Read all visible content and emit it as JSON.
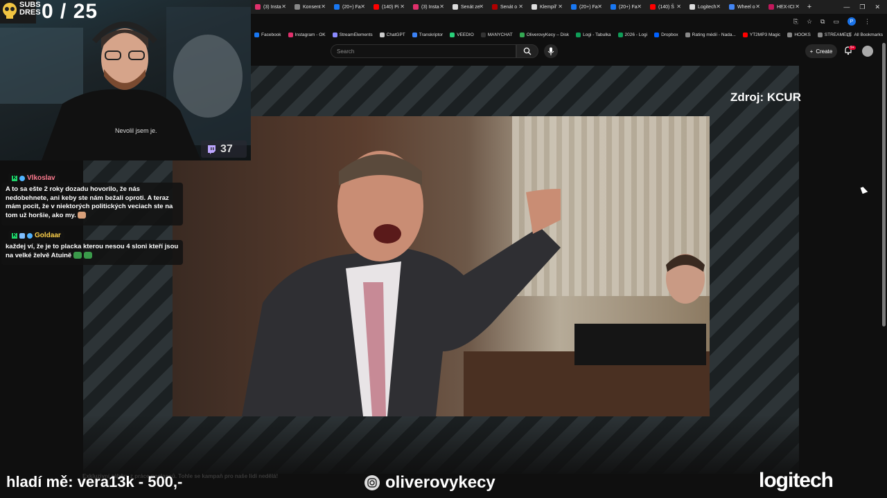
{
  "browser": {
    "tabs": [
      {
        "label": "(3) Insta",
        "color": "#e1306c"
      },
      {
        "label": "Konsent",
        "color": "#888888"
      },
      {
        "label": "(20+) Fa",
        "color": "#1877f2"
      },
      {
        "label": "(140) Pi",
        "color": "#ff0000"
      },
      {
        "label": "(3) Insta",
        "color": "#e1306c"
      },
      {
        "label": "Senát ze",
        "color": "#dddddd"
      },
      {
        "label": "Senát o",
        "color": "#b00000"
      },
      {
        "label": "Klempíř",
        "color": "#dddddd"
      },
      {
        "label": "(20+) Fa",
        "color": "#1877f2"
      },
      {
        "label": "(20+) Fa",
        "color": "#1877f2"
      },
      {
        "label": "(140) Š",
        "color": "#ff0000"
      },
      {
        "label": "Logitech",
        "color": "#dddddd"
      },
      {
        "label": "Wheel o",
        "color": "#4285f4"
      },
      {
        "label": "HEX-ICI",
        "color": "#c2185b"
      }
    ],
    "new_tab": "+",
    "profile_initial": "P",
    "bookmarks": [
      {
        "label": "Facebook",
        "color": "#1877f2"
      },
      {
        "label": "Instagram - OK",
        "color": "#e1306c"
      },
      {
        "label": "StreamElements",
        "color": "#8a8aff"
      },
      {
        "label": "ChatGPT",
        "color": "#cccccc"
      },
      {
        "label": "Transkriptor",
        "color": "#3b82f6"
      },
      {
        "label": "VEEDIO",
        "color": "#29d07a"
      },
      {
        "label": "MANYCHAT",
        "color": "#333333"
      },
      {
        "label": "OliverovyKecy – Disk",
        "color": "#34a853"
      },
      {
        "label": "Logi - Tabulka",
        "color": "#0f9d58"
      },
      {
        "label": "2026 - Logi",
        "color": "#0f9d58"
      },
      {
        "label": "Dropbox",
        "color": "#0061ff"
      },
      {
        "label": "Rating médií - Nada...",
        "color": "#888888"
      },
      {
        "label": "YT2MP3 Magic",
        "color": "#ff0000"
      },
      {
        "label": "HOOKS",
        "color": "#888888"
      },
      {
        "label": "STREAMELE",
        "color": "#888888"
      }
    ],
    "all_bookmarks": "All Bookmarks"
  },
  "youtube": {
    "search_placeholder": "Search",
    "create_label": "Create",
    "notification_badge": "9+"
  },
  "video": {
    "source_label": "Zdroj: KCUR",
    "faint_caption": "Exkluzivní záběry z práce poslanců. Tohle se kampaň pro naše lidi nedělá!"
  },
  "stream_overlay": {
    "subs_label_top": "SUBS",
    "subs_label_bottom": "DRES",
    "subs_count": "0 / 25",
    "shirt_text": "Nevolil jsem je.",
    "viewer_count": "37",
    "donation_text": "hladí mě: vera13k - 500,-",
    "channel_name": "oliverovykecy",
    "sponsor": "logitech"
  },
  "chat": [
    {
      "user": "Vlkoslav",
      "user_color": "#ff6b81",
      "message": "A to sa ešte 2 roky dozadu hovorilo, že nás nedobehnete, ani keby ste nám bežali oproti. A teraz mám pocit, že v niektorých politických veciach ste na tom už horšie, ako my."
    },
    {
      "user": "Goldaar",
      "user_color": "#ffd24a",
      "message": "každej ví, že je to placka kterou nesou 4 sloni kteří jsou na velké želvě Atuině"
    }
  ]
}
